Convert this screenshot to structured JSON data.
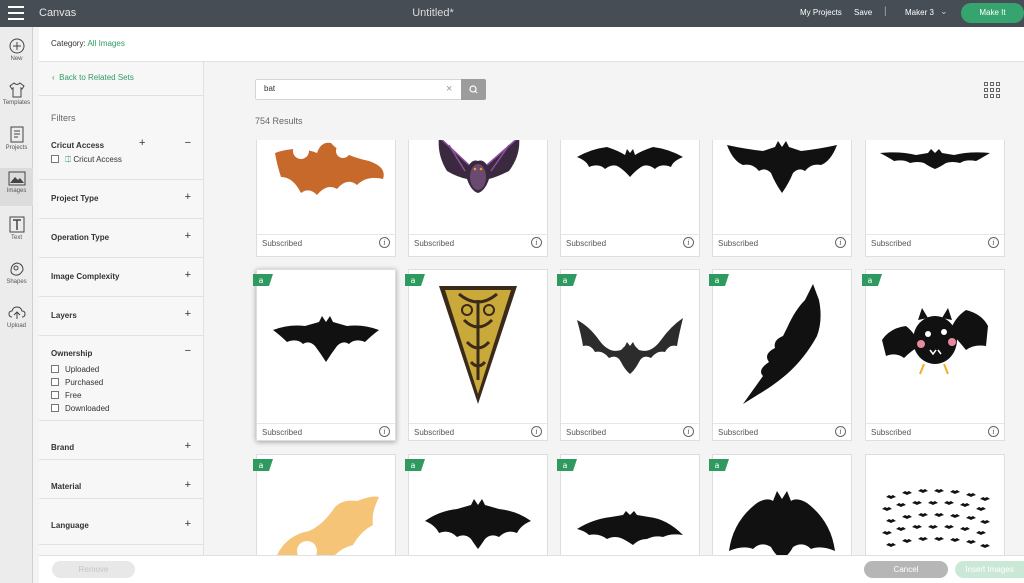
{
  "topbar": {
    "app_title": "Canvas",
    "doc_title": "Untitled*",
    "my_projects": "My Projects",
    "save": "Save",
    "separator": "|",
    "machine": "Maker 3",
    "make_it": "Make It"
  },
  "rail": {
    "items": [
      {
        "label": "New",
        "icon": "plus-circle-icon"
      },
      {
        "label": "Templates",
        "icon": "shirt-icon"
      },
      {
        "label": "Projects",
        "icon": "projects-icon"
      },
      {
        "label": "Images",
        "icon": "image-icon"
      },
      {
        "label": "Text",
        "icon": "text-icon"
      },
      {
        "label": "Shapes",
        "icon": "shapes-icon"
      },
      {
        "label": "Upload",
        "icon": "upload-icon"
      }
    ]
  },
  "category": {
    "label": "Category:",
    "value": "All Images"
  },
  "filters": {
    "back_label": "Back to Related Sets",
    "title": "Filters",
    "cricut_access": {
      "label": "Cricut Access",
      "option": "Cricut Access"
    },
    "sections": [
      "Project Type",
      "Operation Type",
      "Image Complexity",
      "Layers",
      "Ownership",
      "Brand",
      "Material",
      "Language"
    ],
    "ownership_options": [
      "Uploaded",
      "Purchased",
      "Free",
      "Downloaded"
    ]
  },
  "search": {
    "value": "bat",
    "results": "754 Results"
  },
  "cards": {
    "subscribed_label": "Subscribed",
    "info_glyph": "i"
  },
  "bottom": {
    "remove": "Remove",
    "cancel": "Cancel",
    "insert": "Insert Images"
  },
  "colors": {
    "topbar": "#464d55",
    "accent_green": "#2f9b64",
    "make_it_green": "#36a46e"
  }
}
